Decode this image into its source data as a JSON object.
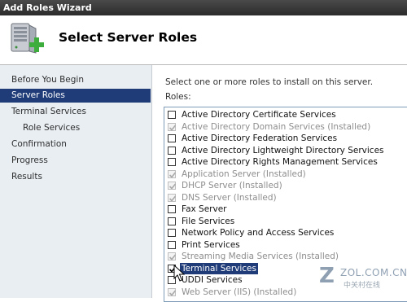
{
  "window": {
    "title": "Add Roles Wizard"
  },
  "header": {
    "title": "Select Server Roles",
    "icon": "server-add-icon"
  },
  "sidebar": {
    "items": [
      {
        "label": "Before You Begin",
        "selected": false,
        "sub": false
      },
      {
        "label": "Server Roles",
        "selected": true,
        "sub": false
      },
      {
        "label": "Terminal Services",
        "selected": false,
        "sub": false
      },
      {
        "label": "Role Services",
        "selected": false,
        "sub": true
      },
      {
        "label": "Confirmation",
        "selected": false,
        "sub": false
      },
      {
        "label": "Progress",
        "selected": false,
        "sub": false
      },
      {
        "label": "Results",
        "selected": false,
        "sub": false
      }
    ]
  },
  "main": {
    "instruction": "Select one or more roles to install on this server.",
    "roles_label": "Roles:",
    "roles": [
      {
        "label": "Active Directory Certificate Services",
        "checked": false,
        "installed": false
      },
      {
        "label": "Active Directory Domain Services  (Installed)",
        "checked": true,
        "installed": true
      },
      {
        "label": "Active Directory Federation Services",
        "checked": false,
        "installed": false
      },
      {
        "label": "Active Directory Lightweight Directory Services",
        "checked": false,
        "installed": false
      },
      {
        "label": "Active Directory Rights Management Services",
        "checked": false,
        "installed": false
      },
      {
        "label": "Application Server  (Installed)",
        "checked": true,
        "installed": true
      },
      {
        "label": "DHCP Server  (Installed)",
        "checked": true,
        "installed": true
      },
      {
        "label": "DNS Server  (Installed)",
        "checked": true,
        "installed": true
      },
      {
        "label": "Fax Server",
        "checked": false,
        "installed": false
      },
      {
        "label": "File Services",
        "checked": false,
        "installed": false
      },
      {
        "label": "Network Policy and Access Services",
        "checked": false,
        "installed": false
      },
      {
        "label": "Print Services",
        "checked": false,
        "installed": false
      },
      {
        "label": "Streaming Media Services  (Installed)",
        "checked": true,
        "installed": true
      },
      {
        "label": "Terminal Services",
        "checked": true,
        "installed": false,
        "highlight": true
      },
      {
        "label": "UDDI Services",
        "checked": false,
        "installed": false
      },
      {
        "label": "Web Server (IIS)  (Installed)",
        "checked": true,
        "installed": true
      }
    ]
  },
  "watermark": {
    "url": "ZOL.COM.CN",
    "cn": "中关村在线"
  },
  "colors": {
    "selection": "#1f3c78",
    "sidebar_bg": "#e9eef3",
    "installed_text": "#8d8d8d"
  }
}
